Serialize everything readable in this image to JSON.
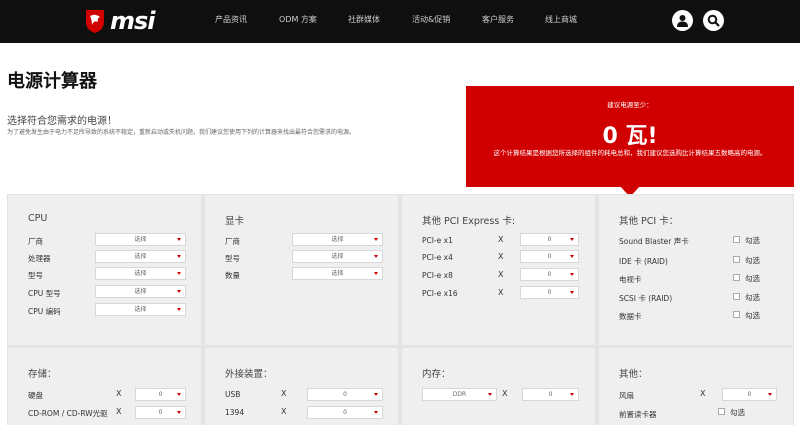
{
  "nav": {
    "logo_text": "msi",
    "items": [
      "产品资讯",
      "ODM 方案",
      "社群媒体",
      "活动&促销",
      "客户服务",
      "线上商城"
    ]
  },
  "page": {
    "title": "电源计算器",
    "intro_heading": "选择符合您需求的电源！",
    "intro_note": "为了避免发生由于电力不足所导致的系统不稳定，重新启动或失机问题，我们建议您使用下列的计算器来找出最符合您需求的电源。"
  },
  "recommendation": {
    "label": "建议电源至少：",
    "value": "0 瓦!",
    "note": "这个计算结果是根据您所选择的组件的耗电总和，我们建议您选购比计算结果五数略高的电源。"
  },
  "cpu": {
    "title": "CPU",
    "rows": [
      {
        "label": "厂商",
        "value": "选择"
      },
      {
        "label": "处理器",
        "value": "选择"
      },
      {
        "label": "型号",
        "value": "选择"
      },
      {
        "label": "CPU 型号",
        "value": "选择"
      },
      {
        "label": "CPU 编码",
        "value": "选择"
      }
    ]
  },
  "gpu": {
    "title": "显卡",
    "rows": [
      {
        "label": "厂商",
        "value": "选择"
      },
      {
        "label": "型号",
        "value": "选择"
      },
      {
        "label": "数量",
        "value": "选择"
      }
    ]
  },
  "pcie": {
    "title": "其他 PCI Express 卡:",
    "x": "X",
    "rows": [
      {
        "label": "PCI-e x1",
        "value": "0"
      },
      {
        "label": "PCI-e x4",
        "value": "0"
      },
      {
        "label": "PCI-e x8",
        "value": "0"
      },
      {
        "label": "PCI-e x16",
        "value": "0"
      }
    ]
  },
  "pci": {
    "title": "其他 PCI 卡：",
    "check_label": "勾选",
    "rows": [
      "Sound Blaster 声卡",
      "IDE 卡 (RAID)",
      "电视卡",
      "SCSI 卡 (RAID)",
      "数据卡"
    ]
  },
  "storage": {
    "title": "存储：",
    "x": "X",
    "rows": [
      {
        "label": "硬盘",
        "value": "0"
      },
      {
        "label": "CD-ROM / CD-RW光驱",
        "value": "0"
      }
    ]
  },
  "external": {
    "title": "外接装置：",
    "x": "X",
    "rows": [
      {
        "label": "USB",
        "value": "0"
      },
      {
        "label": "1394",
        "value": "0"
      }
    ]
  },
  "memory": {
    "title": "内存：",
    "type_value": "DDR",
    "x": "X",
    "count_value": "0"
  },
  "other": {
    "title": "其他：",
    "x": "X",
    "fan_label": "风扇",
    "fan_value": "0",
    "card_reader_label": "前置读卡器",
    "check_label": "勾选"
  },
  "colors": {
    "accent": "#d10000",
    "nav_bg": "#0f0f0f",
    "panel_bg": "#efefef"
  }
}
